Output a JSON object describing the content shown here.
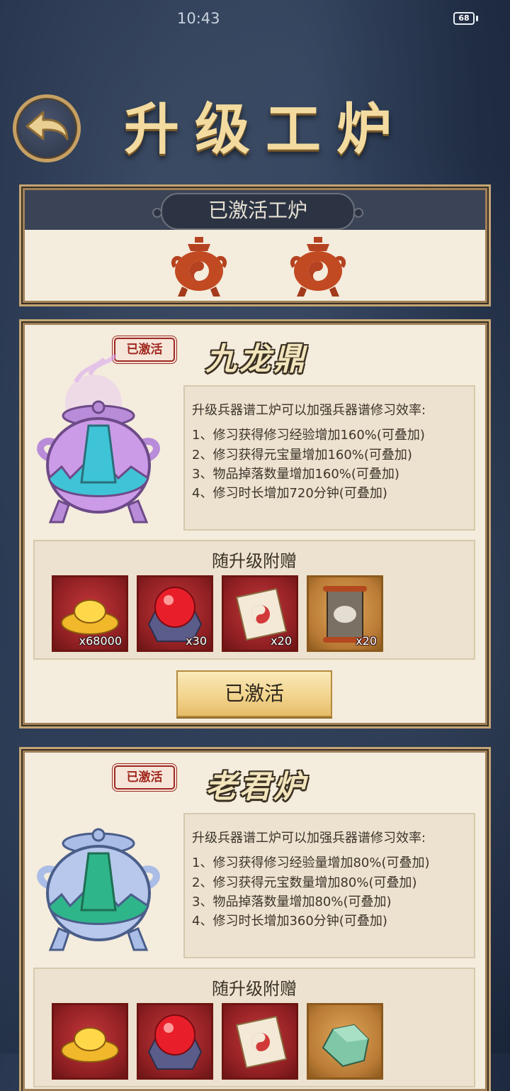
{
  "status_bar": {
    "time": "10:43",
    "battery": "68"
  },
  "page": {
    "title": "升级工炉"
  },
  "active_furnaces": {
    "title": "已激活工炉",
    "count": 2
  },
  "cards": [
    {
      "badge": "已激活",
      "name": "九龙鼎",
      "desc_title": "升级兵器谱工炉可以加强兵器谱修习效率:",
      "desc_lines": [
        "1、修习获得修习经验增加160%(可叠加)",
        "2、修习获得元宝量增加160%(可叠加)",
        "3、物品掉落数量增加160%(可叠加)",
        "4、修习时长增加720分钟(可叠加)"
      ],
      "rewards_title": "随升级附赠",
      "rewards": [
        {
          "icon": "gold-ingot-icon",
          "qty": "x68000"
        },
        {
          "icon": "fire-orb-icon",
          "qty": "x30"
        },
        {
          "icon": "taiji-scroll-icon",
          "qty": "x20"
        },
        {
          "icon": "beast-scroll-icon",
          "qty": "x20"
        }
      ],
      "button": "已激活",
      "colors": {
        "pot": "#cc9be8",
        "trim": "#3ec4d6"
      }
    },
    {
      "badge": "已激活",
      "name": "老君炉",
      "desc_title": "升级兵器谱工炉可以加强兵器谱修习效率:",
      "desc_lines": [
        "1、修习获得修习经验量增加80%(可叠加)",
        "2、修习获得元宝数量增加80%(可叠加)",
        "3、物品掉落数量增加80%(可叠加)",
        "4、修习时长增加360分钟(可叠加)"
      ],
      "rewards_title": "随升级附赠",
      "rewards": [
        {
          "icon": "gold-ingot-icon",
          "qty": ""
        },
        {
          "icon": "fire-orb-icon",
          "qty": ""
        },
        {
          "icon": "taiji-scroll-icon",
          "qty": ""
        },
        {
          "icon": "jade-stone-icon",
          "qty": ""
        }
      ],
      "colors": {
        "pot": "#b7c8ec",
        "trim": "#2fb58a"
      }
    }
  ]
}
